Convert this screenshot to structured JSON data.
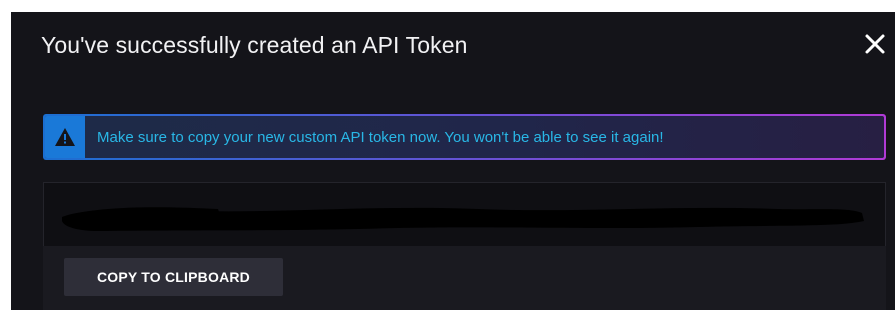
{
  "modal": {
    "title": "You've successfully created an API Token",
    "close_icon": "close-icon"
  },
  "alert": {
    "icon": "warning-triangle-icon",
    "message": "Make sure to copy your new custom API token now. You won't be able to see it again!",
    "accent_color": "#1a79d8",
    "text_color": "#29b7e6"
  },
  "token": {
    "value_redacted": true
  },
  "actions": {
    "copy_label": "COPY TO CLIPBOARD"
  },
  "colors": {
    "modal_background": "#141419",
    "border_gradient_start": "#1b6fd1",
    "border_gradient_end": "#b13ad6"
  }
}
